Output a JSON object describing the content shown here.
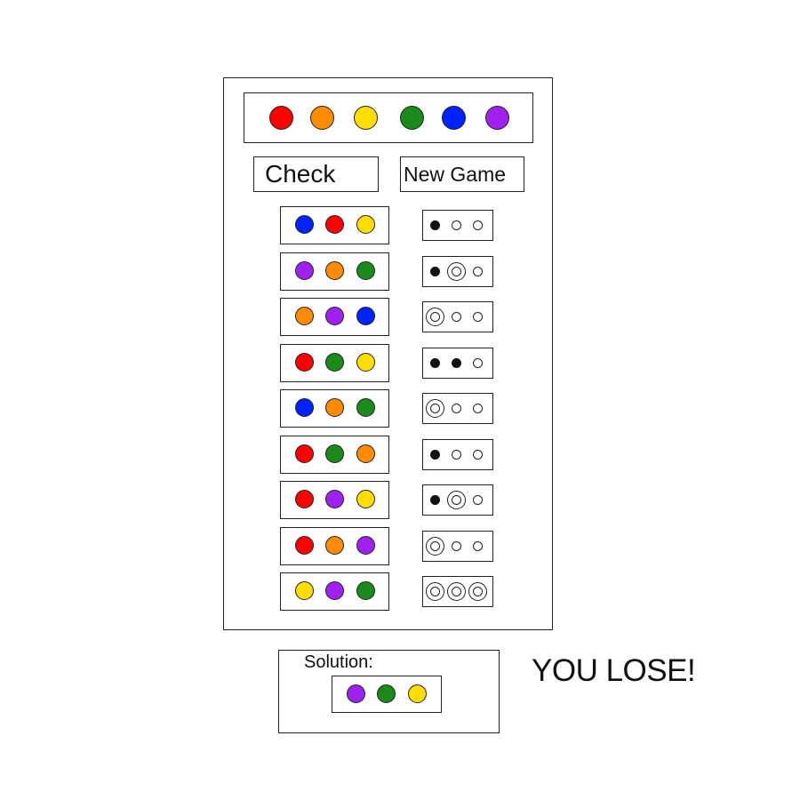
{
  "colors": {
    "red": "#ff0000",
    "orange": "#ff8c00",
    "yellow": "#ffdd00",
    "green": "#1a8a1a",
    "blue": "#0022ff",
    "purple": "#a020f0"
  },
  "palette": [
    "red",
    "orange",
    "yellow",
    "green",
    "blue",
    "purple"
  ],
  "buttons": {
    "check_label": "Check",
    "new_game_label": "New Game"
  },
  "guesses": [
    {
      "pegs": [
        "blue",
        "red",
        "yellow"
      ],
      "feedback": [
        "black",
        "empty",
        "empty"
      ]
    },
    {
      "pegs": [
        "purple",
        "orange",
        "green"
      ],
      "feedback": [
        "black",
        "white",
        "empty"
      ]
    },
    {
      "pegs": [
        "orange",
        "purple",
        "blue"
      ],
      "feedback": [
        "white",
        "empty",
        "empty"
      ]
    },
    {
      "pegs": [
        "red",
        "green",
        "yellow"
      ],
      "feedback": [
        "black",
        "black",
        "empty"
      ]
    },
    {
      "pegs": [
        "blue",
        "orange",
        "green"
      ],
      "feedback": [
        "white",
        "empty",
        "empty"
      ]
    },
    {
      "pegs": [
        "red",
        "green",
        "orange"
      ],
      "feedback": [
        "black",
        "empty",
        "empty"
      ]
    },
    {
      "pegs": [
        "red",
        "purple",
        "yellow"
      ],
      "feedback": [
        "black",
        "white",
        "empty"
      ]
    },
    {
      "pegs": [
        "red",
        "orange",
        "purple"
      ],
      "feedback": [
        "white",
        "empty",
        "empty"
      ]
    },
    {
      "pegs": [
        "yellow",
        "purple",
        "green"
      ],
      "feedback": [
        "white",
        "white",
        "white"
      ]
    }
  ],
  "solution": {
    "label": "Solution:",
    "pegs": [
      "purple",
      "green",
      "yellow"
    ]
  },
  "status": "YOU LOSE!"
}
